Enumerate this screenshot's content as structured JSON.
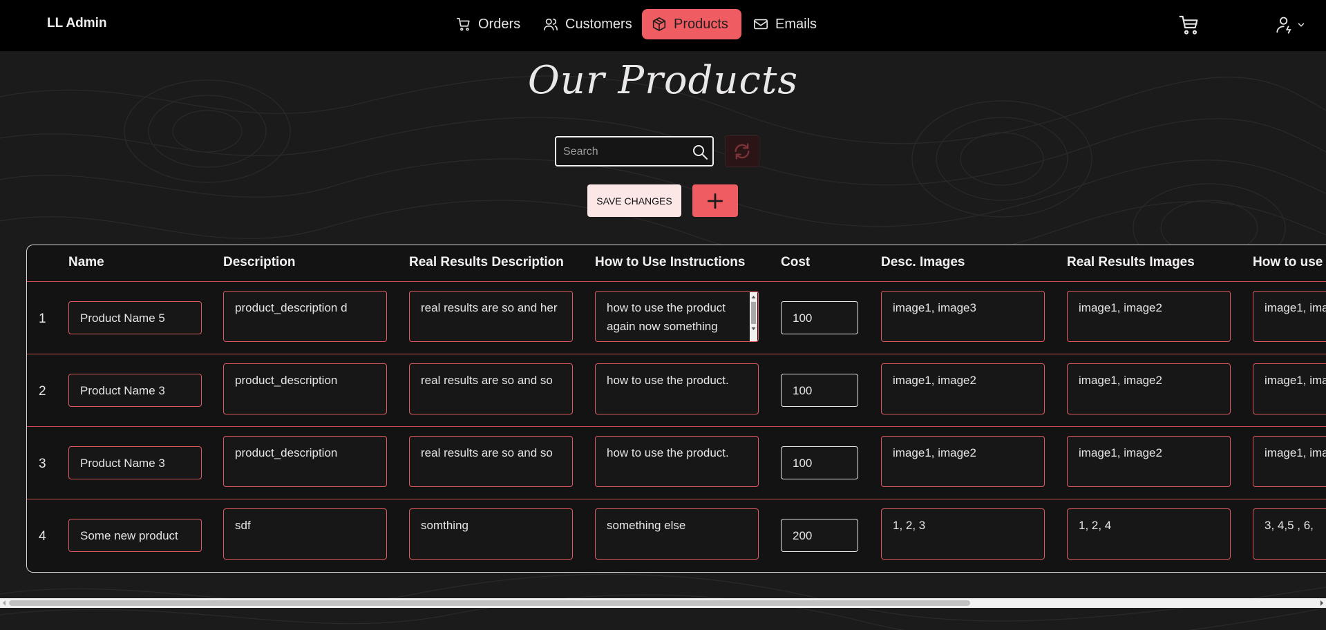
{
  "app": {
    "brand": "LL Admin"
  },
  "nav": {
    "items": [
      {
        "label": "Orders",
        "icon": "cart-icon",
        "active": false
      },
      {
        "label": "Customers",
        "icon": "users-icon",
        "active": false
      },
      {
        "label": "Products",
        "icon": "box-icon",
        "active": true
      },
      {
        "label": "Emails",
        "icon": "mail-icon",
        "active": false
      }
    ],
    "accent": "#ef5d63"
  },
  "page": {
    "title": "Our Products",
    "search_placeholder": "Search",
    "save_label": "SAVE CHANGES"
  },
  "table": {
    "columns": [
      "Name",
      "Description",
      "Real Results Description",
      "How to Use Instructions",
      "Cost",
      "Desc. Images",
      "Real Results Images",
      "How to use I"
    ],
    "rows": [
      {
        "index": "1",
        "name": "Product Name 5",
        "description": "product_description d",
        "real_results": "real results are so and her",
        "how_to_use": "how to use the product again now something",
        "cost": "100",
        "desc_images": "image1, image3",
        "real_results_images": "image1, image2",
        "how_to_use_images": "image1, ima"
      },
      {
        "index": "2",
        "name": "Product Name 3",
        "description": "product_description",
        "real_results": "real results are so and so",
        "how_to_use": "how to use the product.",
        "cost": "100",
        "desc_images": "image1, image2",
        "real_results_images": "image1, image2",
        "how_to_use_images": "image1, ima"
      },
      {
        "index": "3",
        "name": "Product Name 3",
        "description": "product_description",
        "real_results": "real results are so and so",
        "how_to_use": "how to use the product.",
        "cost": "100",
        "desc_images": "image1, image2",
        "real_results_images": "image1, image2",
        "how_to_use_images": "image1, ima"
      },
      {
        "index": "4",
        "name": "Some new product",
        "description": "sdf",
        "real_results": "somthing",
        "how_to_use": "something else",
        "cost": "200",
        "desc_images": "1, 2, 3",
        "real_results_images": "1, 2, 4",
        "how_to_use_images": "3, 4,5 , 6,"
      }
    ]
  }
}
